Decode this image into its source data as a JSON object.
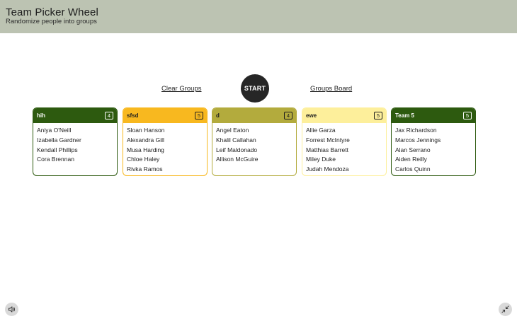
{
  "header": {
    "title": "Team Picker Wheel",
    "subtitle": "Randomize people into groups"
  },
  "controls": {
    "clear_label": "Clear Groups",
    "start_label": "START",
    "board_label": "Groups Board"
  },
  "colors": {
    "header_bg": "#bcc3b2",
    "start_bg": "#262626"
  },
  "groups": [
    {
      "name": "hih",
      "count": "4",
      "color": "#2d5a0f",
      "text_color": "#ffffff",
      "members": [
        "Aniya O'Neill",
        "Izabella Gardner",
        "Kendall Phillips",
        "Cora Brennan"
      ]
    },
    {
      "name": "sfsd",
      "count": "5",
      "color": "#f8b81f",
      "text_color": "#1e1e1e",
      "members": [
        "Sloan Hanson",
        "Alexandra Gill",
        "Musa Harding",
        "Chloe Haley",
        "Rivka Ramos"
      ]
    },
    {
      "name": "d",
      "count": "4",
      "color": "#b3ab3d",
      "text_color": "#1e1e1e",
      "members": [
        "Angel Eaton",
        "Khalil Callahan",
        "Leif Maldonado",
        "Allison McGuire"
      ]
    },
    {
      "name": "ewe",
      "count": "5",
      "color": "#fdef9b",
      "text_color": "#1e1e1e",
      "members": [
        "Allie Garza",
        "Forrest McIntyre",
        "Matthias Barrett",
        "Miley Duke",
        "Judah Mendoza"
      ]
    },
    {
      "name": "Team 5",
      "count": "5",
      "color": "#2d5a0f",
      "text_color": "#ffffff",
      "members": [
        "Jax Richardson",
        "Marcos Jennings",
        "Alan Serrano",
        "Aiden Reilly",
        "Carlos Quinn"
      ]
    }
  ],
  "icons": {
    "sound": "speaker-icon",
    "collapse": "collapse-icon"
  }
}
